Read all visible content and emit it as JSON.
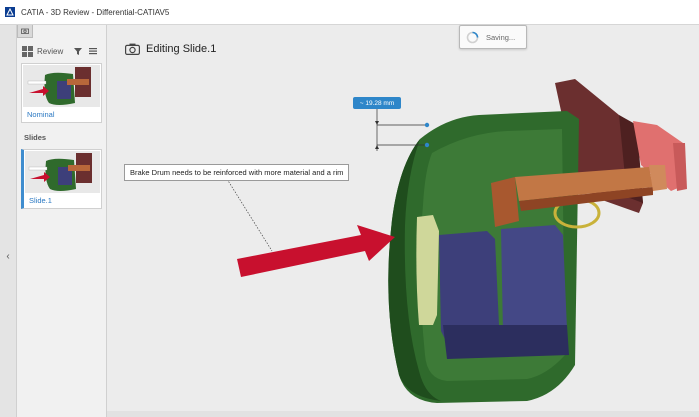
{
  "window": {
    "title": "CATIA - 3D Review - Differential-CATIAV5",
    "logo": "catia-logo-icon"
  },
  "panel": {
    "review_label": "Review",
    "tools": [
      "filter-icon",
      "menu-icon"
    ],
    "views": [
      {
        "label": "Nominal"
      }
    ],
    "slides_section": "Slides",
    "slides": [
      {
        "label": "Slide.1",
        "selected": true
      }
    ]
  },
  "viewport": {
    "editing_label": "Editing Slide.1",
    "saving_status": "Saving...",
    "dimension_label": "~ 19.28 mm",
    "annotation_text": "Brake Drum needs to be reinforced with more material and a rim"
  },
  "colors": {
    "accent": "#2e86c9",
    "arrow": "#c8102e",
    "drum_green": "#2f6a2c",
    "shoe_blue": "#3d3f7a",
    "flange_maroon": "#6b2f2f",
    "shaft_orange": "#b8673a"
  }
}
